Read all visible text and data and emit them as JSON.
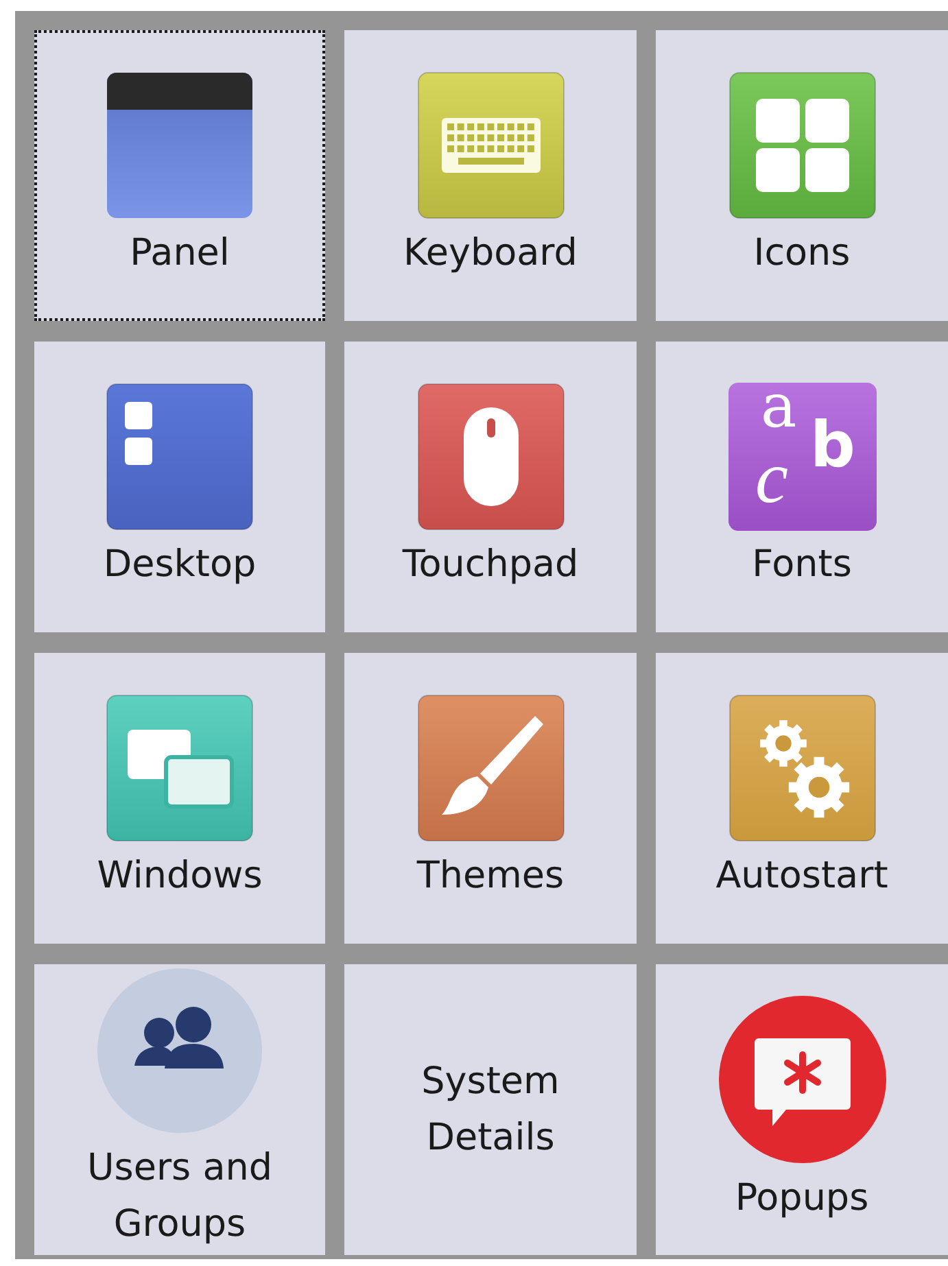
{
  "items": [
    {
      "label": "Panel",
      "kind": "panel",
      "selected": true
    },
    {
      "label": "Keyboard",
      "kind": "keyboard",
      "selected": false
    },
    {
      "label": "Icons",
      "kind": "icons",
      "selected": false
    },
    {
      "label": "Desktop",
      "kind": "desktop",
      "selected": false
    },
    {
      "label": "Touchpad",
      "kind": "touchpad",
      "selected": false
    },
    {
      "label": "Fonts",
      "kind": "fonts",
      "selected": false,
      "glyphs": [
        "a",
        "c",
        "b"
      ]
    },
    {
      "label": "Windows",
      "kind": "windows",
      "selected": false
    },
    {
      "label": "Themes",
      "kind": "themes",
      "selected": false
    },
    {
      "label": "Autostart",
      "kind": "autostart",
      "selected": false
    },
    {
      "label": "Users and Groups",
      "kind": "users",
      "selected": false
    },
    {
      "label": "System Details",
      "kind": "text",
      "selected": false
    },
    {
      "label": "Popups",
      "kind": "popups",
      "selected": false
    }
  ]
}
